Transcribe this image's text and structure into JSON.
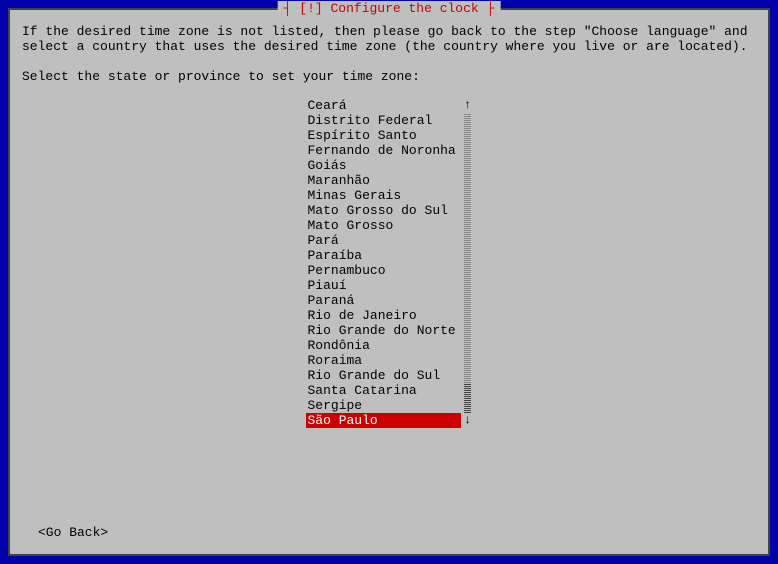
{
  "dialog": {
    "title": "[!] Configure the clock",
    "instruction": "If the desired time zone is not listed, then please go back to the step \"Choose language\" and select a country that uses the desired time zone (the country where you live or are located).",
    "prompt": "Select the state or province to set your time zone:",
    "go_back": "<Go Back>"
  },
  "timezone_list": {
    "items": [
      "Ceará",
      "Distrito Federal",
      "Espírito Santo",
      "Fernando de Noronha",
      "Goiás",
      "Maranhão",
      "Minas Gerais",
      "Mato Grosso do Sul",
      "Mato Grosso",
      "Pará",
      "Paraíba",
      "Pernambuco",
      "Piauí",
      "Paraná",
      "Rio de Janeiro",
      "Rio Grande do Norte",
      "Rondônia",
      "Roraima",
      "Rio Grande do Sul",
      "Santa Catarina",
      "Sergipe",
      "São Paulo"
    ],
    "selected_index": 21
  }
}
